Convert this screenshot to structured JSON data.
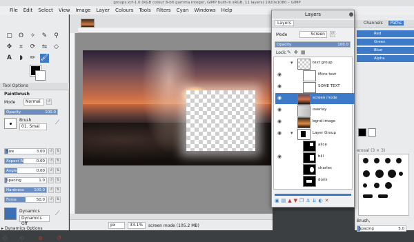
{
  "window_title": "groups.xcf-1.0 (RGB colour 8-bit gamma integer, GIMP built-in sRGB, 11 layers) 1920x1080 – GIMP",
  "menu": [
    "File",
    "Edit",
    "Select",
    "View",
    "Image",
    "Layer",
    "Colours",
    "Tools",
    "Filters",
    "Cyan",
    "Windows",
    "Help"
  ],
  "tool_options": {
    "tab_label": "Tool Options",
    "tool_name": "Paintbrush",
    "mode_label": "Mode",
    "mode_value": "Normal",
    "opacity_label": "Opacity",
    "opacity_value": "100.0",
    "brush_label": "Brush",
    "brush_name": "01. Smal",
    "size_label": "Size",
    "size_value": "3.00",
    "aspect_label": "Aspect Ratio",
    "aspect_value": "0.00",
    "angle_label": "Angle",
    "angle_value": "0.00",
    "spacing_label": "Spacing",
    "spacing_value": "1.0",
    "hardness_label": "Hardness",
    "hardness_value": "100.0",
    "force_label": "Force",
    "force_value": "50.0",
    "dynamics_label": "Dynamics",
    "dynamics_value": "Dynamics Off",
    "dynamics_options_label": "Dynamics Options"
  },
  "status": {
    "unit": "px",
    "zoom": "33.1%",
    "info": "screen mode (105.2 MB)"
  },
  "layers_dialog": {
    "title": "Layers",
    "tab_label": "Layers",
    "mode_label": "Mode",
    "mode_value": "Screen",
    "opacity_label": "Opacity",
    "opacity_value": "100.0",
    "lock_label": "Lock:",
    "layers": [
      {
        "name": "text group"
      },
      {
        "name": "More text"
      },
      {
        "name": "SOME TEXT"
      },
      {
        "name": "screen mode"
      },
      {
        "name": "overlay"
      },
      {
        "name": "bgnd-image"
      },
      {
        "name": "Layer Group"
      },
      {
        "name": "alice"
      },
      {
        "name": "bill"
      },
      {
        "name": "charles"
      },
      {
        "name": "doris"
      }
    ]
  },
  "channels": {
    "tab_channels": "Channels",
    "tab_paths": "Paths",
    "items": [
      "Red",
      "Green",
      "Blue",
      "Alpha"
    ],
    "brush_filter_label": "erosal (3 × 3)",
    "brush_section_label": "Brush,",
    "spacing_label": "Spacing",
    "spacing_value": "5.0"
  }
}
